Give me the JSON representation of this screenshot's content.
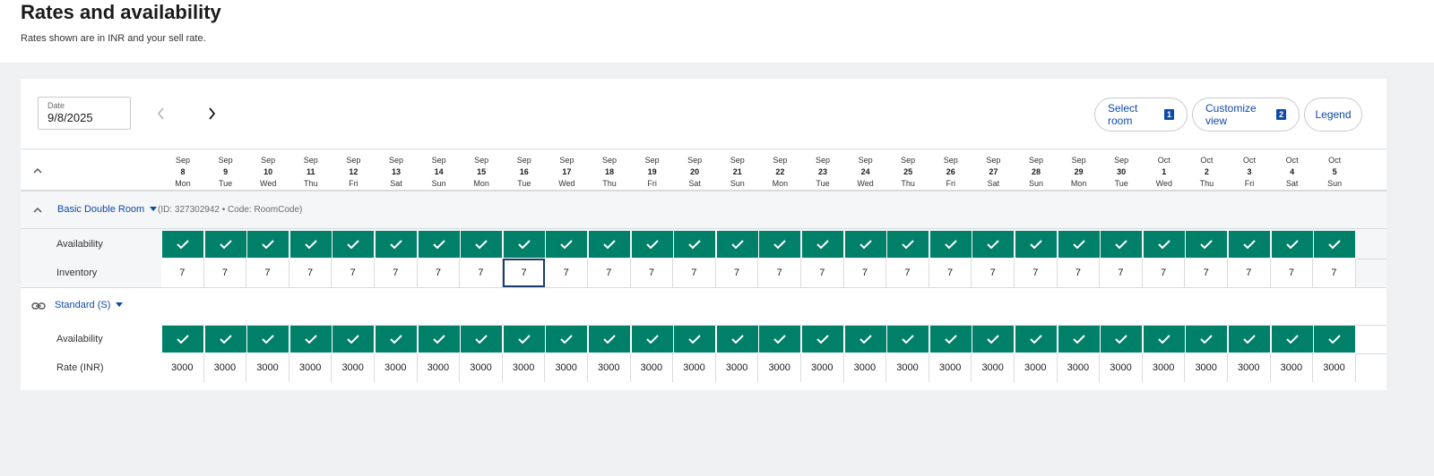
{
  "header": {
    "title": "Rates and availability",
    "subtitle": "Rates shown are in INR and your sell rate."
  },
  "toolbar": {
    "date_label": "Date",
    "date_value": "9/8/2025",
    "select_room": {
      "label": "Select room",
      "badge": "1"
    },
    "customize_view": {
      "label": "Customize view",
      "badge": "2"
    },
    "legend": "Legend"
  },
  "days": [
    {
      "month": "Sep",
      "day": "8",
      "weekday": "Mon"
    },
    {
      "month": "Sep",
      "day": "9",
      "weekday": "Tue"
    },
    {
      "month": "Sep",
      "day": "10",
      "weekday": "Wed"
    },
    {
      "month": "Sep",
      "day": "11",
      "weekday": "Thu"
    },
    {
      "month": "Sep",
      "day": "12",
      "weekday": "Fri"
    },
    {
      "month": "Sep",
      "day": "13",
      "weekday": "Sat"
    },
    {
      "month": "Sep",
      "day": "14",
      "weekday": "Sun"
    },
    {
      "month": "Sep",
      "day": "15",
      "weekday": "Mon"
    },
    {
      "month": "Sep",
      "day": "16",
      "weekday": "Tue"
    },
    {
      "month": "Sep",
      "day": "17",
      "weekday": "Wed"
    },
    {
      "month": "Sep",
      "day": "18",
      "weekday": "Thu"
    },
    {
      "month": "Sep",
      "day": "19",
      "weekday": "Fri"
    },
    {
      "month": "Sep",
      "day": "20",
      "weekday": "Sat"
    },
    {
      "month": "Sep",
      "day": "21",
      "weekday": "Sun"
    },
    {
      "month": "Sep",
      "day": "22",
      "weekday": "Mon"
    },
    {
      "month": "Sep",
      "day": "23",
      "weekday": "Tue"
    },
    {
      "month": "Sep",
      "day": "24",
      "weekday": "Wed"
    },
    {
      "month": "Sep",
      "day": "25",
      "weekday": "Thu"
    },
    {
      "month": "Sep",
      "day": "26",
      "weekday": "Fri"
    },
    {
      "month": "Sep",
      "day": "27",
      "weekday": "Sat"
    },
    {
      "month": "Sep",
      "day": "28",
      "weekday": "Sun"
    },
    {
      "month": "Sep",
      "day": "29",
      "weekday": "Mon"
    },
    {
      "month": "Sep",
      "day": "30",
      "weekday": "Tue"
    },
    {
      "month": "Oct",
      "day": "1",
      "weekday": "Wed"
    },
    {
      "month": "Oct",
      "day": "2",
      "weekday": "Thu"
    },
    {
      "month": "Oct",
      "day": "3",
      "weekday": "Fri"
    },
    {
      "month": "Oct",
      "day": "4",
      "weekday": "Sat"
    },
    {
      "month": "Oct",
      "day": "5",
      "weekday": "Sun"
    }
  ],
  "room": {
    "name": "Basic Double Room",
    "meta": "(ID: 327302942 • Code: RoomCode)",
    "availability_label": "Availability",
    "inventory_label": "Inventory",
    "inventory": [
      "7",
      "7",
      "7",
      "7",
      "7",
      "7",
      "7",
      "7",
      "7",
      "7",
      "7",
      "7",
      "7",
      "7",
      "7",
      "7",
      "7",
      "7",
      "7",
      "7",
      "7",
      "7",
      "7",
      "7",
      "7",
      "7",
      "7",
      "7"
    ]
  },
  "rate_plan": {
    "name": "Standard (S)",
    "availability_label": "Availability",
    "rate_label": "Rate (INR)",
    "rates": [
      "3000",
      "3000",
      "3000",
      "3000",
      "3000",
      "3000",
      "3000",
      "3000",
      "3000",
      "3000",
      "3000",
      "3000",
      "3000",
      "3000",
      "3000",
      "3000",
      "3000",
      "3000",
      "3000",
      "3000",
      "3000",
      "3000",
      "3000",
      "3000",
      "3000",
      "3000",
      "3000",
      "3000"
    ]
  },
  "colors": {
    "available": "#008069",
    "link": "#0e4ba8",
    "focus_border": "#1a3d6d"
  },
  "icons": {
    "prev": "chevron-left-icon",
    "next": "chevron-right-icon",
    "collapse": "chevron-up-icon",
    "available": "checkmark-icon",
    "linked": "link-icon"
  },
  "focused_cell": "8"
}
